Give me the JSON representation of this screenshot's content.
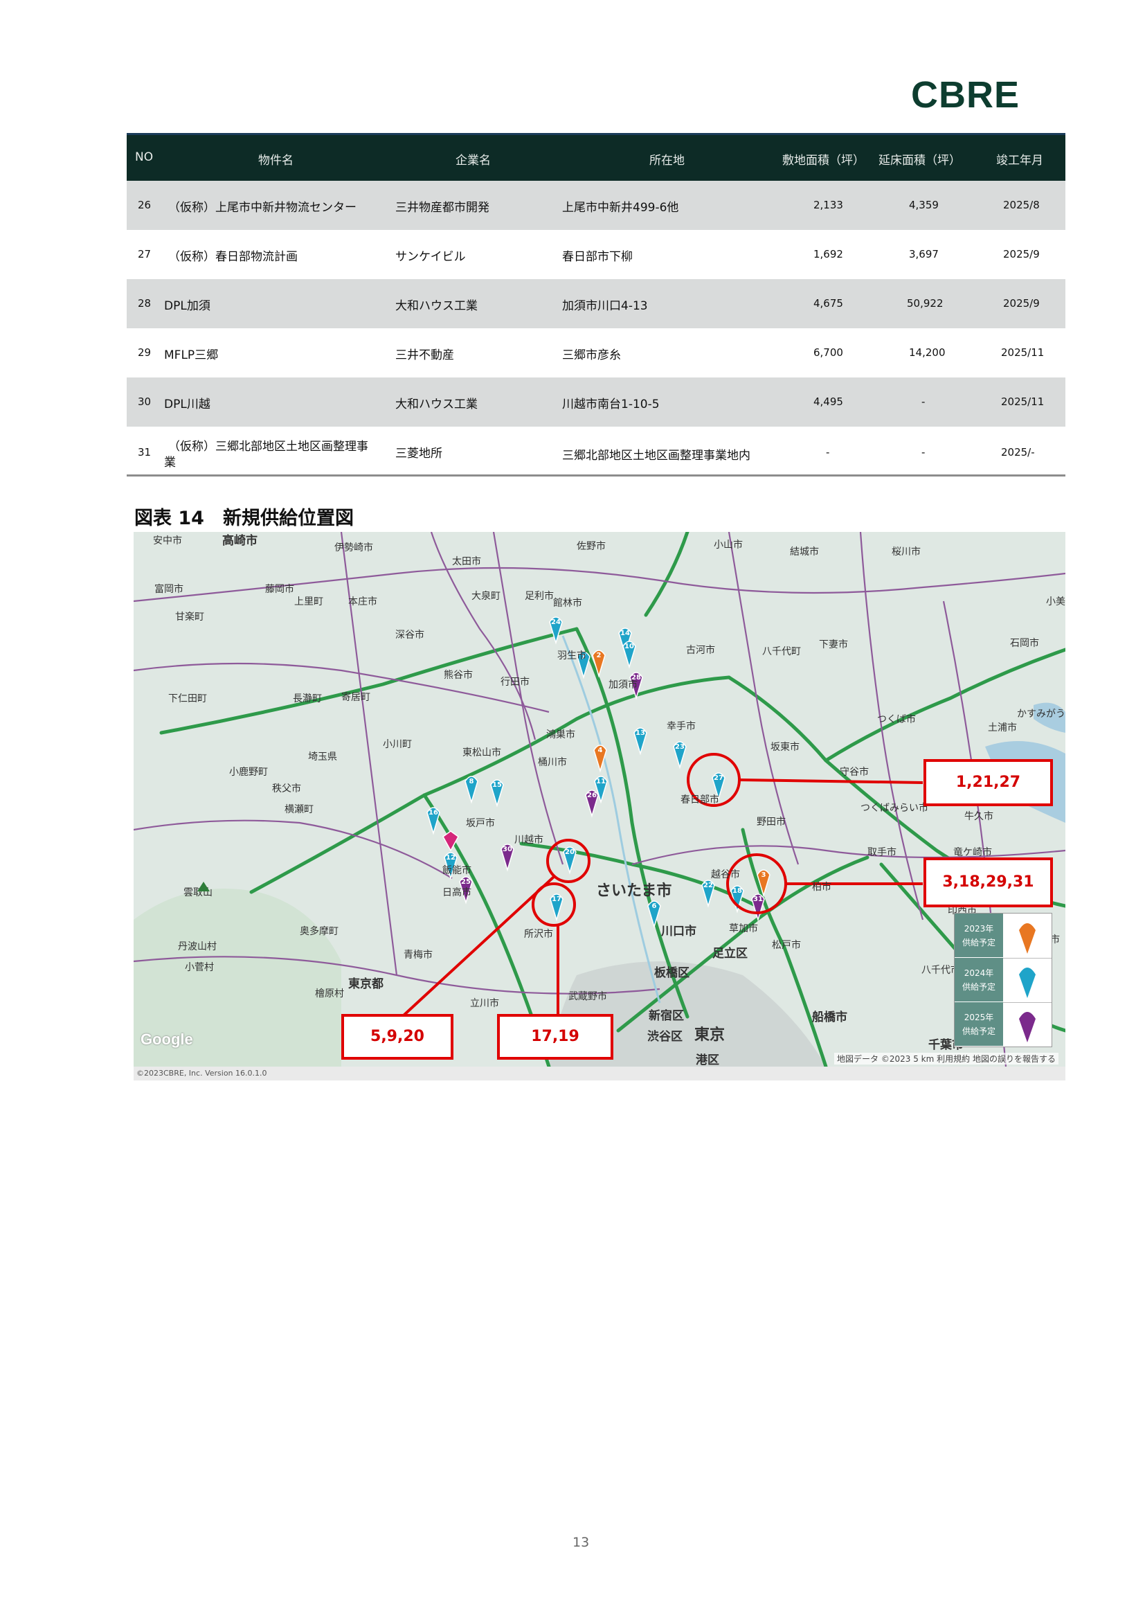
{
  "logo": "CBRE",
  "table": {
    "headers": [
      "NO",
      "物件名",
      "企業名",
      "所在地",
      "敷地面積（坪）",
      "延床面積（坪）",
      "竣工年月"
    ],
    "rows": [
      {
        "no": "26",
        "name": "（仮称）上尾市中新井物流センター",
        "company": "三井物産都市開発",
        "location": "上尾市中新井499-6他",
        "site": "2,133",
        "floor": "4,359",
        "date": "2025/8"
      },
      {
        "no": "27",
        "name": "（仮称）春日部物流計画",
        "company": "サンケイビル",
        "location": "春日部市下柳",
        "site": "1,692",
        "floor": "3,697",
        "date": "2025/9"
      },
      {
        "no": "28",
        "name": "DPL加須",
        "company": "大和ハウス工業",
        "location": "加須市川口4-13",
        "site": "4,675",
        "floor": "50,922",
        "date": "2025/9"
      },
      {
        "no": "29",
        "name": "MFLP三郷",
        "company": "三井不動産",
        "location": "三郷市彦糸",
        "site": "6,700",
        "floor": "14,200",
        "date": "2025/11"
      },
      {
        "no": "30",
        "name": "DPL川越",
        "company": "大和ハウス工業",
        "location": "川越市南台1-10-5",
        "site": "4,495",
        "floor": "-",
        "date": "2025/11"
      },
      {
        "no": "31",
        "name_line1": "（仮称）三郷北部地区土地区画整理事",
        "name_line2": "業",
        "company": "三菱地所",
        "location": "三郷北部地区土地区画整理事業地内",
        "site": "-",
        "floor": "-",
        "date": "2025/-"
      }
    ]
  },
  "figure_title": "図表 14　新規供給位置図",
  "map": {
    "places": [
      "安中市",
      "高崎市",
      "伊勢崎市",
      "太田市",
      "佐野市",
      "小山市",
      "結城市",
      "桜川市",
      "富岡市",
      "藤岡市",
      "上里町",
      "本庄市",
      "大泉町",
      "足利市",
      "館林市",
      "古河市",
      "八千代町",
      "下妻市",
      "甘楽町",
      "深谷市",
      "羽生市",
      "加須市",
      "小美",
      "石岡市",
      "熊谷市",
      "行田市",
      "つくば市",
      "かすみがう",
      "下仁田町",
      "長瀞町",
      "寄居町",
      "鴻巣市",
      "幸手市",
      "坂東市",
      "土浦市",
      "小川町",
      "東松山市",
      "桶川市",
      "守谷市",
      "埼玉県",
      "小鹿野町",
      "秩父市",
      "坂戸市",
      "川越市",
      "春日部市",
      "野田市",
      "牛久市",
      "横瀬町",
      "つくばみらい市",
      "飯能市",
      "日高市",
      "取手市",
      "竜ケ崎市",
      "さいたま市",
      "越谷市",
      "柏市",
      "印西市",
      "雲取山",
      "所沢市",
      "川口市",
      "草加市",
      "松戸市",
      "成田市",
      "奥多摩町",
      "青梅市",
      "足立区",
      "八千代市",
      "丹波山村",
      "小菅村",
      "東京都",
      "武蔵野市",
      "板橋区",
      "船橋市",
      "立川市",
      "新宿区",
      "檜原村",
      "渋谷区",
      "東京",
      "港区",
      "千葉市",
      "Google",
      "©2023CBRE, Inc.  Version  16.0.1.0",
      "地図データ ©2023  5 km",
      "利用規約",
      "地図の誤りを報告する"
    ],
    "callouts": [
      "1,21,27",
      "3,18,29,31",
      "5,9,20",
      "17,19"
    ],
    "legend": [
      {
        "label_line1": "2023年",
        "label_line2": "供給予定",
        "color": "#e87722"
      },
      {
        "label_line1": "2024年",
        "label_line2": "供給予定",
        "color": "#1fa4c9"
      },
      {
        "label_line1": "2025年",
        "label_line2": "供給予定",
        "color": "#7b2a8c"
      }
    ],
    "pins": [
      "1",
      "2",
      "3",
      "4",
      "5",
      "6",
      "7",
      "8",
      "9",
      "10",
      "11",
      "12",
      "13",
      "14",
      "15",
      "16",
      "17",
      "18",
      "19",
      "20",
      "21",
      "22",
      "23",
      "24",
      "25",
      "26",
      "27",
      "28",
      "29",
      "30",
      "31"
    ]
  },
  "page_number": "13"
}
